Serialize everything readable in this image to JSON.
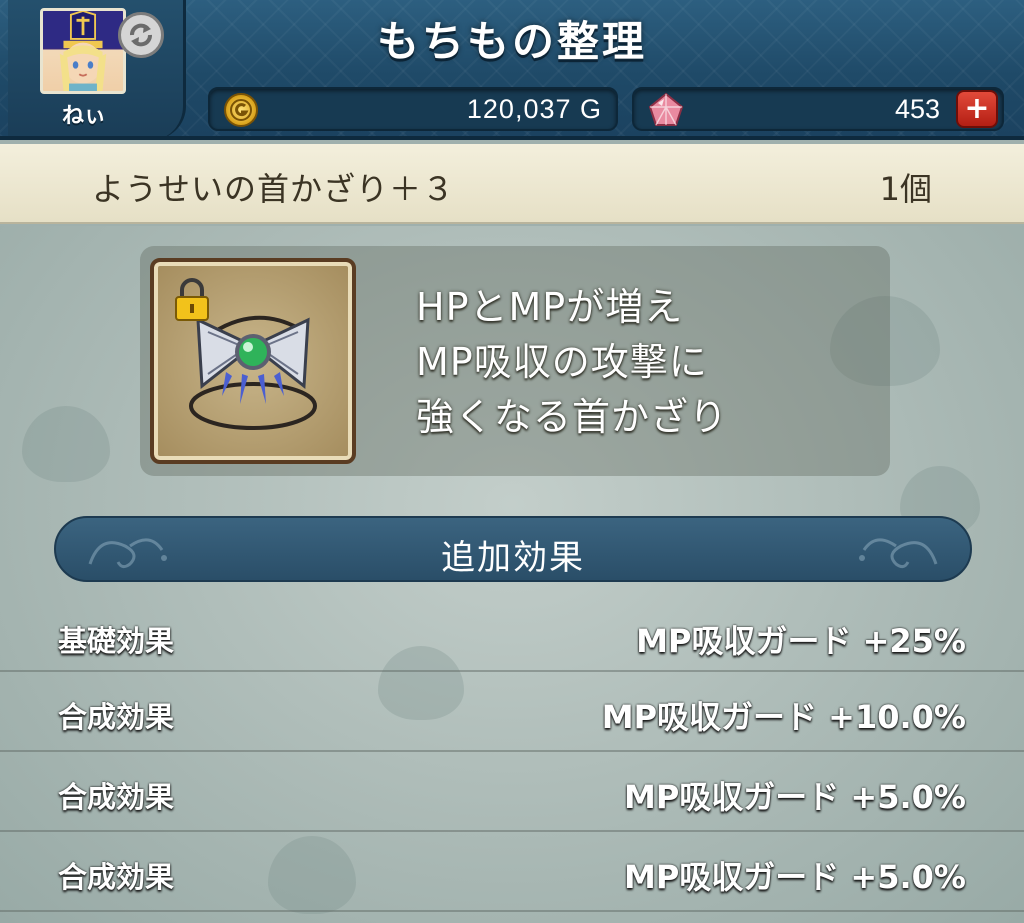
{
  "header": {
    "title": "もちもの整理",
    "player_name": "ねぃ",
    "gold": "120,037 G",
    "gems": "453",
    "add_gems_label": "+"
  },
  "item": {
    "name": "ようせいの首かざり＋３",
    "count": "1個",
    "description_lines": [
      "HPとMPが増え",
      "MP吸収の攻撃に",
      "強くなる首かざり"
    ],
    "locked": true
  },
  "effects": {
    "title": "追加効果",
    "rows": [
      {
        "label": "基礎効果",
        "value": "MP吸収ガード +25%"
      },
      {
        "label": "合成効果",
        "value": "MP吸収ガード +10.0%"
      },
      {
        "label": "合成効果",
        "value": "MP吸収ガード +5.0%"
      },
      {
        "label": "合成効果",
        "value": "MP吸収ガード +5.0%"
      }
    ]
  },
  "icons": {
    "refresh": "refresh-icon",
    "coin": "gold-coin-icon",
    "gem": "gem-icon",
    "lock": "lock-icon",
    "item": "necklace-icon"
  },
  "colors": {
    "header_bg": "#2d5f80",
    "item_bar_bg": "#f3efdc",
    "plus_button": "#d2392b",
    "text_dark": "#3b3424"
  }
}
